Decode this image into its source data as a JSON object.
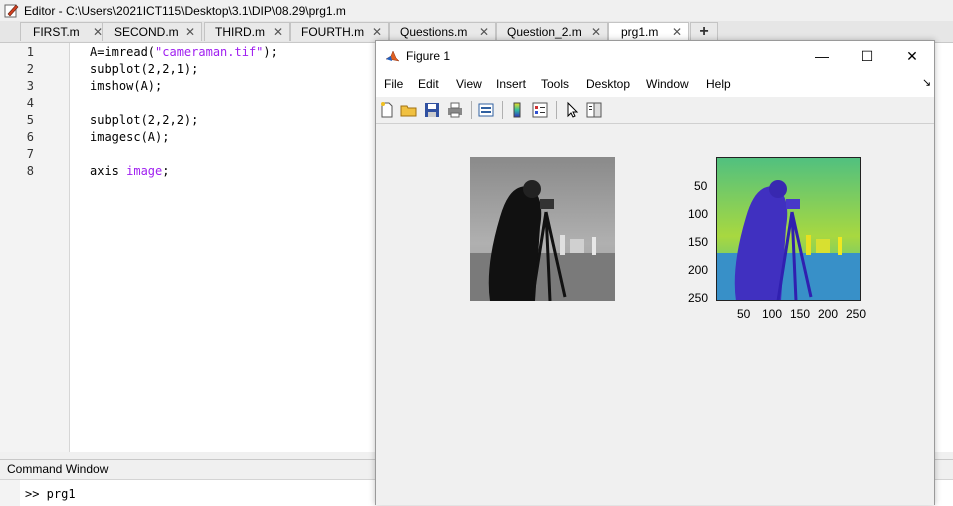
{
  "window": {
    "title": "Editor - C:\\Users\\2021ICT115\\Desktop\\3.1\\DIP\\08.29\\prg1.m"
  },
  "tabs": [
    {
      "label": "FIRST.m",
      "close": "✕"
    },
    {
      "label": "SECOND.m",
      "close": "✕"
    },
    {
      "label": "THIRD.m",
      "close": "✕"
    },
    {
      "label": "FOURTH.m",
      "close": "✕"
    },
    {
      "label": "Questions.m",
      "close": "✕"
    },
    {
      "label": "Question_2.m",
      "close": "✕"
    },
    {
      "label": "prg1.m",
      "close": "✕"
    }
  ],
  "new_tab_label": "+",
  "editor": {
    "line_numbers": [
      "1",
      "2",
      "3",
      "4",
      "5",
      "6",
      "7",
      "8"
    ],
    "lines": {
      "l1_pre": "A=imread(",
      "l1_str": "\"cameraman.tif\"",
      "l1_post": ");",
      "l2": "subplot(2,2,1);",
      "l3": "imshow(A);",
      "l5": "subplot(2,2,2);",
      "l6": "imagesc(A);",
      "l8_pre": "axis ",
      "l8_str": "image",
      "l8_post": ";"
    }
  },
  "command_window": {
    "title": "Command Window",
    "prompt": ">> prg1"
  },
  "figure": {
    "title": "Figure 1",
    "window_buttons": {
      "minimize": "—",
      "maximize": "☐",
      "close": "✕"
    },
    "menu": [
      "File",
      "Edit",
      "View",
      "Insert",
      "Tools",
      "Desktop",
      "Window",
      "Help"
    ],
    "menu_arrow": "↘",
    "toolbar_icons": [
      "new-figure-icon",
      "open-file-icon",
      "save-icon",
      "print-icon",
      "link-icon",
      "colorbar-icon",
      "legend-icon",
      "pointer-icon",
      "property-inspector-icon"
    ],
    "plot2": {
      "y_ticks": [
        "50",
        "100",
        "150",
        "200",
        "250"
      ],
      "x_ticks": [
        "50",
        "100",
        "150",
        "200",
        "250"
      ]
    }
  },
  "colors": {
    "string": "#a020f0",
    "active_tab": "#ffffff",
    "figure_bg": "#f0f0f0"
  }
}
